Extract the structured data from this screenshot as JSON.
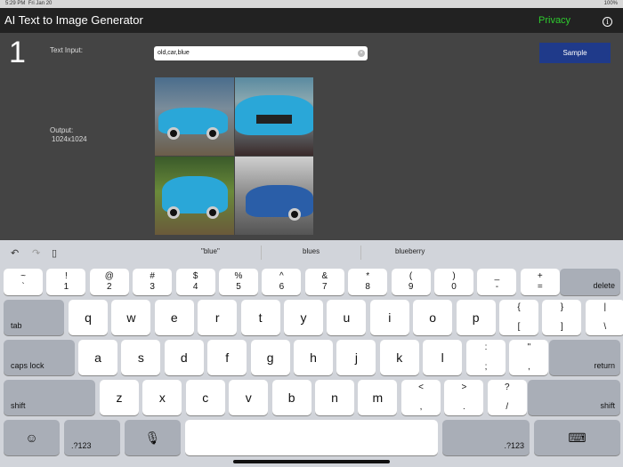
{
  "status": {
    "time": "5:29 PM",
    "date": "Fri Jan 20",
    "battery": "100%"
  },
  "header": {
    "title": "AI Text to Image Generator",
    "privacy": "Privacy",
    "info_icon": "i"
  },
  "main": {
    "step": "1",
    "text_input_label": "Text Input:",
    "text_input_value": "old,car,blue",
    "sample_button": "Sample",
    "output_label": "Output:",
    "output_size": "1024x1024"
  },
  "keyboard": {
    "suggestions": [
      "\"blue\"",
      "blues",
      "blueberry"
    ],
    "row1": [
      [
        "~",
        "`"
      ],
      [
        "!",
        "1"
      ],
      [
        "@",
        "2"
      ],
      [
        "#",
        "3"
      ],
      [
        "$",
        "4"
      ],
      [
        "%",
        "5"
      ],
      [
        "^",
        "6"
      ],
      [
        "&",
        "7"
      ],
      [
        "*",
        "8"
      ],
      [
        "(",
        "9"
      ],
      [
        ")",
        "0"
      ],
      [
        "_",
        "-"
      ],
      [
        "+",
        "="
      ]
    ],
    "delete": "delete",
    "tab": "tab",
    "row2": [
      "q",
      "w",
      "e",
      "r",
      "t",
      "y",
      "u",
      "i",
      "o",
      "p"
    ],
    "row2b": [
      [
        "{",
        "["
      ],
      [
        "}",
        "]"
      ],
      [
        "|",
        "\\"
      ]
    ],
    "caps": "caps lock",
    "row3": [
      "a",
      "s",
      "d",
      "f",
      "g",
      "h",
      "j",
      "k",
      "l"
    ],
    "row3b": [
      [
        ":",
        ";"
      ],
      [
        "\"",
        ","
      ]
    ],
    "return": "return",
    "shift": "shift",
    "row4": [
      "z",
      "x",
      "c",
      "v",
      "b",
      "n",
      "m"
    ],
    "row4b": [
      [
        "<",
        ","
      ],
      [
        ">",
        "."
      ],
      [
        "?",
        "/"
      ]
    ],
    "numbers": ".?123",
    "emoji": "☺",
    "mic": "🎙",
    "hide": "⌨"
  }
}
